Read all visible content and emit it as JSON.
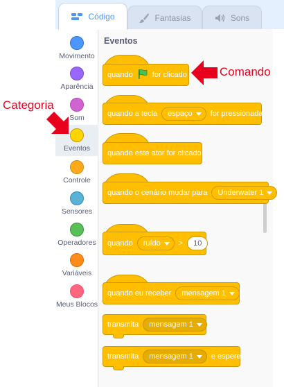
{
  "tabs": [
    {
      "label": "Código",
      "icon": "code-icon",
      "active": true
    },
    {
      "label": "Fantasias",
      "icon": "paintbrush-icon",
      "active": false
    },
    {
      "label": "Sons",
      "icon": "speaker-icon",
      "active": false
    }
  ],
  "categories": [
    {
      "label": "Movimento",
      "color": "#4c97ff"
    },
    {
      "label": "Aparência",
      "color": "#9966ff"
    },
    {
      "label": "Som",
      "color": "#cf63cf"
    },
    {
      "label": "Eventos",
      "color": "#ffd500"
    },
    {
      "label": "Controle",
      "color": "#ffab19"
    },
    {
      "label": "Sensores",
      "color": "#5cb1d6"
    },
    {
      "label": "Operadores",
      "color": "#59c059"
    },
    {
      "label": "Variáveis",
      "color": "#ff8c1a"
    },
    {
      "label": "Meus Blocos",
      "color": "#ff6680"
    }
  ],
  "selected_category": "Eventos",
  "section_title": "Eventos",
  "blocks": {
    "flag": {
      "prefix": "quando",
      "suffix": "for clicado",
      "icon": "green-flag-icon"
    },
    "key": {
      "prefix": "quando a tecla",
      "option": "espaço",
      "suffix": "for pressionada"
    },
    "sprite_click": {
      "text": "quando este ator for clicado"
    },
    "backdrop": {
      "prefix": "quando o cenário mudar para",
      "option": "Underwater 1"
    },
    "sensor": {
      "prefix": "quando",
      "option": "ruído",
      "operator": ">",
      "value": "10"
    },
    "receive": {
      "prefix": "quando eu receber",
      "option": "mensagem 1"
    },
    "broadcast": {
      "prefix": "transmita",
      "option": "mensagem 1"
    },
    "broadcast_wait": {
      "prefix": "transmita",
      "option": "mensagem 1",
      "suffix": "e espere"
    }
  },
  "annotations": {
    "comando": "Comando",
    "categoria": "Categoria"
  },
  "colors": {
    "events": "#ffbf00",
    "events_border": "#cc9900",
    "annotation": "#e8001c",
    "accent": "#4c97ff"
  }
}
